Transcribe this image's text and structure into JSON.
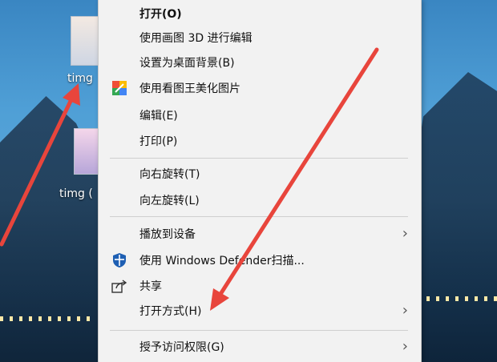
{
  "desktop": {
    "files": [
      {
        "label": "timg",
        "icon": "image-file-icon"
      },
      {
        "label": "timg (",
        "icon": "image-file-icon"
      }
    ]
  },
  "context_menu": {
    "items": [
      {
        "label": "打开(O)",
        "bold": true
      },
      {
        "label": "使用画图 3D 进行编辑"
      },
      {
        "label": "设置为桌面背景(B)"
      },
      {
        "label": "使用看图王美化图片",
        "icon": "kantuwang-icon"
      },
      {
        "label": "编辑(E)"
      },
      {
        "label": "打印(P)"
      },
      {
        "label": "向右旋转(T)"
      },
      {
        "label": "向左旋转(L)"
      },
      {
        "label": "播放到设备",
        "submenu": true
      },
      {
        "label": "使用 Windows Defender扫描...",
        "icon": "windows-defender-shield-icon"
      },
      {
        "label": "共享",
        "icon": "share-icon"
      },
      {
        "label": "打开方式(H)",
        "submenu": true
      },
      {
        "label": "授予访问权限(G)",
        "submenu": true
      }
    ]
  },
  "colors": {
    "menu_background": "#f2f2f2",
    "annotation_arrow": "#e8453c",
    "defender_blue": "#1e5fb3"
  }
}
